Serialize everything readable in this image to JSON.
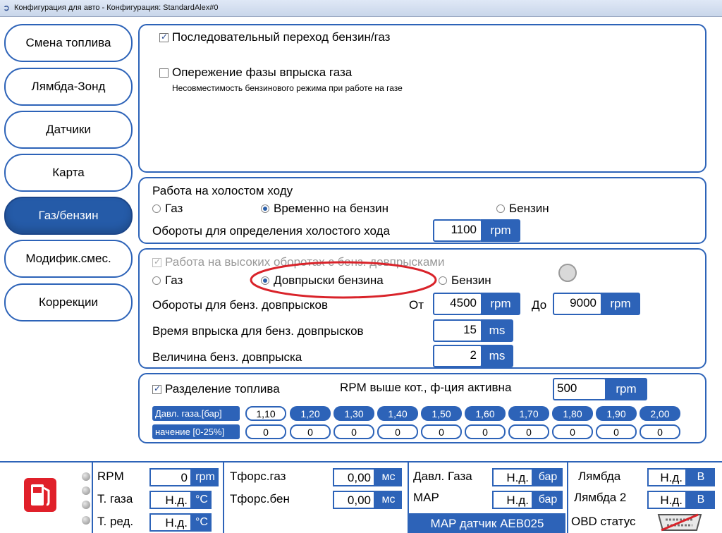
{
  "window": {
    "title": "Конфигурация для авто - Конфигурация: StandardAlex#0"
  },
  "nav": [
    {
      "label": "Смена топлива",
      "active": false
    },
    {
      "label": "Лямбда-Зонд",
      "active": false
    },
    {
      "label": "Датчики",
      "active": false
    },
    {
      "label": "Карта",
      "active": false
    },
    {
      "label": "Газ/бензин",
      "active": true
    },
    {
      "label": "Модифик.смес.",
      "active": false
    },
    {
      "label": "Коррекции",
      "active": false
    }
  ],
  "top_panel": {
    "sequential_label": "Последовательный переход бензин/газ",
    "sequential_checked": true,
    "advance_label": "Опережение фазы впрыска газа",
    "advance_checked": false,
    "advance_note": "Несовместимость бензинового режима при работе на газе"
  },
  "idle_panel": {
    "title": "Работа на холостом ходу",
    "opt_gas": "Газ",
    "opt_temp_petrol": "Временно на бензин",
    "opt_petrol": "Бензин",
    "selected": "Временно на бензин",
    "rpm_label": "Обороты для определения холостого хода",
    "rpm_value": "1100",
    "rpm_unit": "rpm"
  },
  "high_panel": {
    "title": "Работа на высоких оборотах с бенз. довпрысками",
    "title_checked": true,
    "opt_gas": "Газ",
    "opt_extra": "Довпрыски бензина",
    "opt_petrol": "Бензин",
    "selected": "Довпрыски бензина",
    "rpm_label": "Обороты для бенз. довпрысков",
    "from_label": "От",
    "from_value": "4500",
    "to_label": "До",
    "to_value": "9000",
    "rpm_unit": "rpm",
    "time_label": "Время впрыска для бенз. довпрысков",
    "time_value": "15",
    "time_unit": "ms",
    "amount_label": "Величина бенз. довпрыска",
    "amount_value": "2",
    "amount_unit": "ms"
  },
  "split_panel": {
    "label": "Разделение топлива",
    "checked": true,
    "rpm_label": "RPM выше кот., ф-ция активна",
    "rpm_value": "500",
    "rpm_unit": "rpm",
    "pressure_header": "Давл. газа.[бар]",
    "value_header": "начение [0-25%]",
    "pressures": [
      "1,10",
      "1,20",
      "1,30",
      "1,40",
      "1,50",
      "1,60",
      "1,70",
      "1,80",
      "1,90",
      "2,00"
    ],
    "values": [
      "0",
      "0",
      "0",
      "0",
      "0",
      "0",
      "0",
      "0",
      "0",
      "0"
    ]
  },
  "status_bar": {
    "rpm_label": "RPM",
    "rpm_value": "0",
    "rpm_unit": "rpm",
    "tgas_label": "Т. газа",
    "tgas_value": "Н.д.",
    "tgas_unit": "°C",
    "tred_label": "Т. ред.",
    "tred_value": "Н.д.",
    "tred_unit": "°C",
    "tforc_gas_label": "Тфорс.газ",
    "tforc_gas_value": "0,00",
    "tforc_gas_unit": "мс",
    "tforc_petrol_label": "Тфорс.бен",
    "tforc_petrol_value": "0,00",
    "tforc_petrol_unit": "мс",
    "pgas_label": "Давл. Газа",
    "pgas_value": "Н.д.",
    "pgas_unit": "бар",
    "map_label": "MAP",
    "map_value": "Н.д.",
    "map_unit": "бар",
    "map_sensor": "MAP датчик AEB025",
    "lambda_label": "Лямбда",
    "lambda_value": "Н.д.",
    "lambda_unit": "В",
    "lambda2_label": "Лямбда 2",
    "lambda2_value": "Н.д.",
    "lambda2_unit": "В",
    "obd_label": "OBD статус"
  },
  "colors": {
    "accent": "#2d63b8",
    "fuel_icon": "#e0202a",
    "annotation": "#d9232a"
  }
}
